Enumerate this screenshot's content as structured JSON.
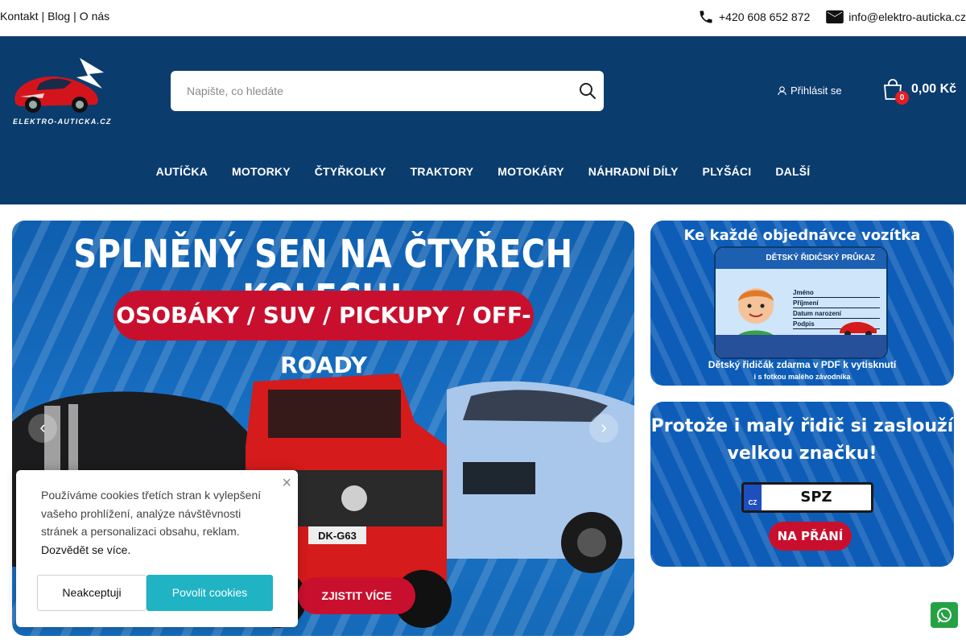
{
  "topbar": {
    "links": [
      "Kontakt",
      "Blog",
      "O nás"
    ],
    "separator": "|",
    "phone": "+420 608 652 872",
    "email": "info@elektro-auticka.cz"
  },
  "header": {
    "logo_text": "ELEKTRO-AUTICKA.CZ",
    "search_placeholder": "Napište, co hledáte",
    "login_label": "Přihlásit se",
    "cart_count": "0",
    "cart_total": "0,00 Kč"
  },
  "nav": {
    "items": [
      "AUTÍČKA",
      "MOTORKY",
      "ČTYŘKOLKY",
      "TRAKTORY",
      "MOTOKÁRY",
      "NÁHRADNÍ DÍLY",
      "PLYŠÁCI",
      "DALŠÍ"
    ]
  },
  "hero": {
    "title": "SPLNĚNÝ SEN NA ČTYŘECH KOLECH!",
    "subtitle": "OSOBÁKY / SUV / PICKUPY / OFF-ROADY",
    "plate_text": "DK-G63",
    "button": "ZJISTIT VÍCE",
    "prev": "‹",
    "next": "›"
  },
  "banner1": {
    "title": "Ke každé objednávce vozítka",
    "card_title": "DĚTSKÝ ŘIDIČSKÝ PRŮKAZ",
    "fields": [
      "Jméno",
      "Příjmení",
      "Datum narození",
      "Podpis"
    ],
    "line1": "Dětský řidičák zdarma v PDF k vytisknutí",
    "line2": "i s fotkou malého závodníka"
  },
  "banner2": {
    "title_line1": "Protože i malý řidič si zaslouží",
    "title_line2": "velkou značku!",
    "eu_code": "CZ",
    "plate": "SPZ",
    "button": "NA PŘÁNÍ"
  },
  "cookie": {
    "message": "Používáme cookies třetích stran k vylepšení vašeho prohlížení, analýze návštěvnosti stránek a personalizaci obsahu, reklam.",
    "more": "Dozvědět se více.",
    "decline": "Neakceptuji",
    "accept": "Povolit cookies",
    "close": "×"
  },
  "colors": {
    "header_bg": "#0b3c6e",
    "accent_red": "#c8102e",
    "cookie_accept": "#1fb3c4",
    "whatsapp": "#25a244"
  }
}
